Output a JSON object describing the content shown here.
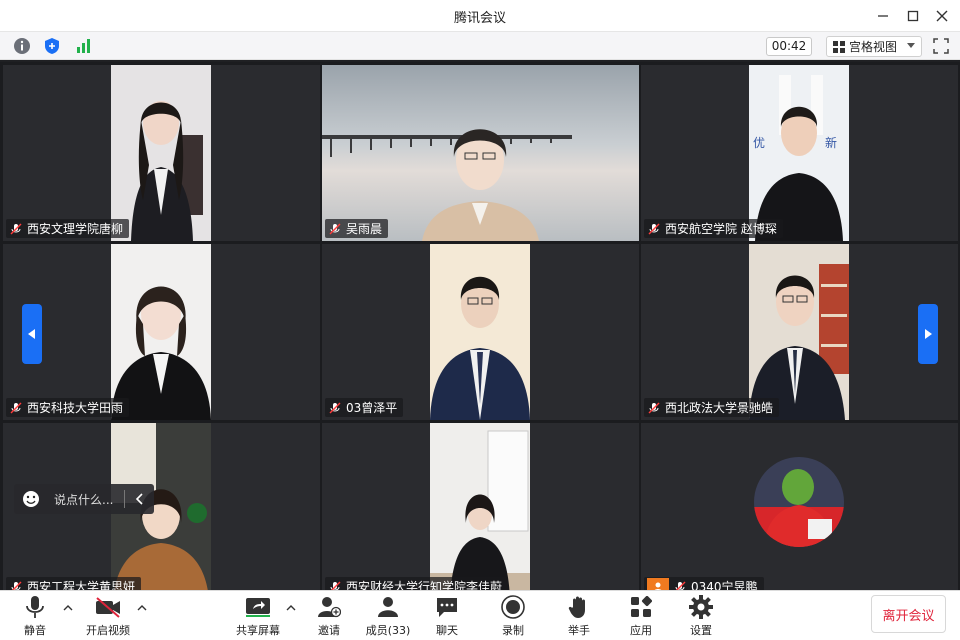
{
  "window": {
    "title": "腾讯会议"
  },
  "infobar": {
    "timer": "00:42",
    "view_mode": "宫格视图"
  },
  "participants": [
    {
      "name": "西安文理学院唐柳"
    },
    {
      "name": "吴雨晨"
    },
    {
      "name": "西安航空学院 赵博琛"
    },
    {
      "name": "西安科技大学田雨"
    },
    {
      "name": "03曾泽平"
    },
    {
      "name": "西北政法大学景驰皓"
    },
    {
      "name": "西安工程大学黄思妍"
    },
    {
      "name": "西安财经大学行知学院李佳蔚"
    },
    {
      "name": "0340宁昱鹏"
    }
  ],
  "chat": {
    "placeholder": "说点什么..."
  },
  "toolbar": {
    "mute": "静音",
    "video": "开启视频",
    "share": "共享屏幕",
    "invite": "邀请",
    "members": "成员(33)",
    "chat": "聊天",
    "record": "录制",
    "raise_hand": "举手",
    "apps": "应用",
    "settings": "设置",
    "leave": "离开会议"
  },
  "colors": {
    "accent": "#1a6ff5",
    "leave": "#e0243b",
    "signal": "#22b14c"
  }
}
